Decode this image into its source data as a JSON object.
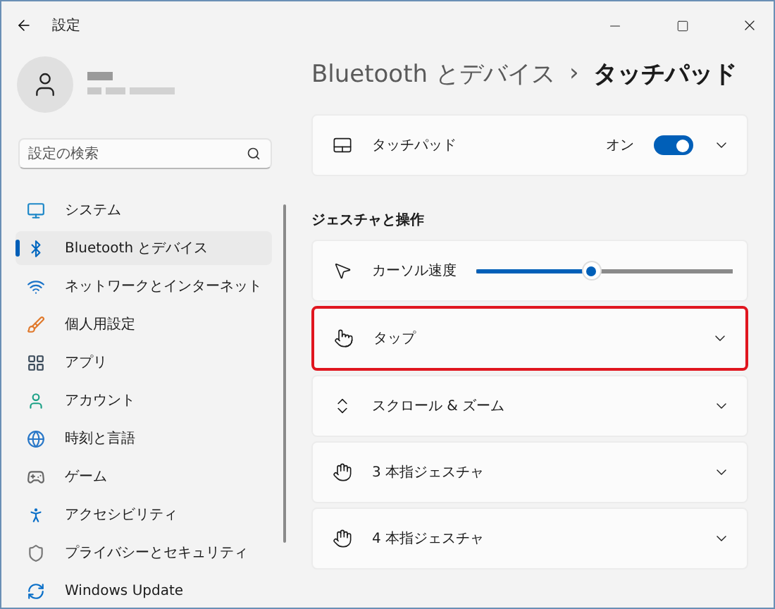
{
  "window": {
    "title": "設定"
  },
  "search": {
    "placeholder": "設定の検索"
  },
  "nav": [
    {
      "kind": "system",
      "label": "システム",
      "selected": false
    },
    {
      "kind": "bluetooth",
      "label": "Bluetooth とデバイス",
      "selected": true
    },
    {
      "kind": "network",
      "label": "ネットワークとインターネット",
      "selected": false
    },
    {
      "kind": "personalize",
      "label": "個人用設定",
      "selected": false
    },
    {
      "kind": "apps",
      "label": "アプリ",
      "selected": false
    },
    {
      "kind": "account",
      "label": "アカウント",
      "selected": false
    },
    {
      "kind": "time",
      "label": "時刻と言語",
      "selected": false
    },
    {
      "kind": "game",
      "label": "ゲーム",
      "selected": false
    },
    {
      "kind": "access",
      "label": "アクセシビリティ",
      "selected": false
    },
    {
      "kind": "privacy",
      "label": "プライバシーとセキュリティ",
      "selected": false
    },
    {
      "kind": "update",
      "label": "Windows Update",
      "selected": false
    }
  ],
  "breadcrumb": {
    "parent": "Bluetooth とデバイス",
    "separator": "›",
    "current": "タッチパッド"
  },
  "touchpad": {
    "label": "タッチパッド",
    "state_label": "オン",
    "on": true
  },
  "section": {
    "title": "ジェスチャと操作"
  },
  "rows": [
    {
      "kind": "slider",
      "label": "カーソル速度",
      "level": 0.45
    },
    {
      "kind": "tap",
      "label": "タップ",
      "highlighted": true
    },
    {
      "kind": "scroll",
      "label": "スクロール & ズーム",
      "highlighted": false
    },
    {
      "kind": "hand",
      "label": "3 本指ジェスチャ",
      "highlighted": false
    },
    {
      "kind": "hand",
      "label": "4 本指ジェスチャ",
      "highlighted": false
    }
  ]
}
